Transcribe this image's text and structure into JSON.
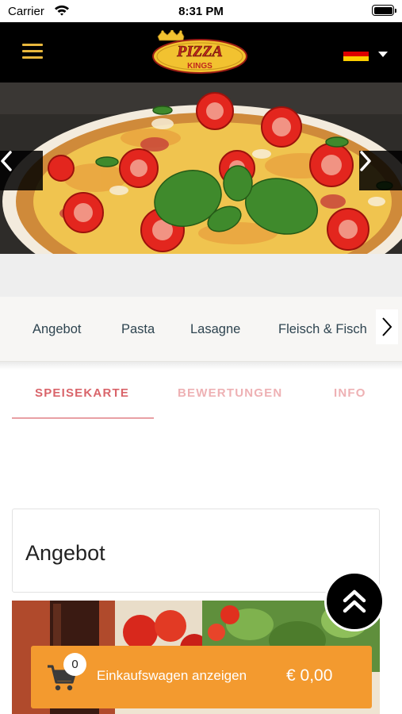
{
  "status_bar": {
    "carrier": "Carrier",
    "time": "8:31 PM"
  },
  "header": {
    "menu_icon": "hamburger-icon",
    "logo_top": "PIZZA",
    "logo_bottom": "KINGS",
    "language_flag": "germany-flag-icon",
    "language_caret": "caret-down-icon"
  },
  "hero": {
    "prev_icon": "chevron-left-icon",
    "next_icon": "chevron-right-icon"
  },
  "categories": {
    "items": [
      "Angebot",
      "Pasta",
      "Lasagne",
      "Fleisch & Fisch"
    ],
    "next_icon": "chevron-right-icon"
  },
  "tabs": {
    "items": [
      "SPEISEKARTE",
      "BEWERTUNGEN",
      "INFO"
    ],
    "active_index": 0
  },
  "section": {
    "title": "Angebot"
  },
  "scroll_top_icon": "double-chevron-up-icon",
  "cart": {
    "icon": "shopping-cart-icon",
    "count": "0",
    "label": "Einkaufswagen anzeigen",
    "total": "€ 0,00"
  },
  "colors": {
    "header_bg": "#000000",
    "accent_tab": "#d9646a",
    "cart_bar": "#f39a2f",
    "category_text": "#2e4450"
  }
}
